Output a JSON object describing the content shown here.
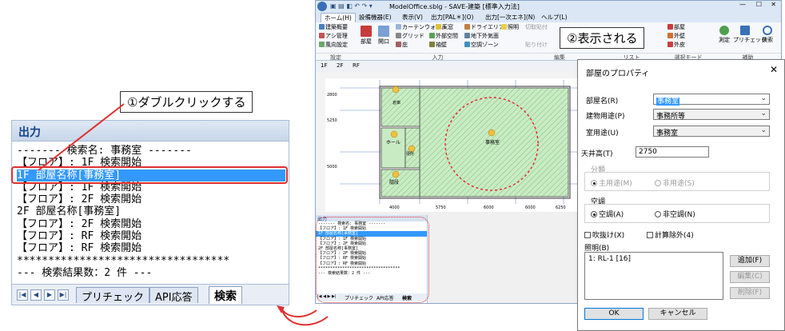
{
  "callout1": "①ダブルクリックする",
  "callout2": "②表示される",
  "output_panel": {
    "title": "出力",
    "lines": [
      "------- 検索名: 事務室 -------",
      "【フロア】: 1F 検索開始",
      "1F 部屋名称[事務室]",
      "【フロア】: 1F 検索開始",
      "【フロア】: 2F 検索開始",
      "2F 部屋名称[事務室]",
      "【フロア】: 2F 検索開始",
      "【フロア】: RF 検索開始",
      "【フロア】: RF 検索開始",
      "**********************************",
      "--- 検索結果数：2 件 ---"
    ],
    "tabs": [
      "プリチェック",
      "API応答",
      "検索"
    ]
  },
  "app": {
    "title": "ModelOffice.sblg - SAVE-建築 [標準入力法]",
    "ribbon_tabs": [
      "ホーム(H)",
      "設備機器(E)",
      "表示(V)",
      "出力[PAL＊](O)",
      "出力[一次エネ](N)",
      "ヘルプ(L)"
    ],
    "ribbon_items": [
      "建築概要",
      "アシ管理",
      "風向設定",
      "部屋",
      "開口",
      "カーテンウォール",
      "グリッド",
      "天窓",
      "外部空間",
      "ドライエリア",
      "地下外気面",
      "庇",
      "袖壁",
      "空調ゾーン",
      "照明",
      "切取貼付",
      "貼り付け",
      "部屋",
      "外壁",
      "外皮",
      "測定",
      "プリチェック",
      "検索"
    ],
    "ribbon_groups": [
      "設定",
      "入力",
      "編集",
      "リスト",
      "選択モード",
      "補助"
    ],
    "floor_tabs": [
      "1F",
      "2F",
      "RF"
    ],
    "room_labels": [
      "事務室",
      "ホール",
      "階段",
      "便所",
      "倉庫"
    ],
    "dims": [
      "4000",
      "5750",
      "6000",
      "6000",
      "6250",
      "2800",
      "5250",
      "5000"
    ],
    "mini_output": {
      "title": "出力",
      "tabs": [
        "プリチェック",
        "API応答",
        "検索"
      ]
    }
  },
  "dialog": {
    "title": "部屋のプロパティ",
    "room_name_label": "部屋名(R)",
    "room_name_value": "事務室",
    "building_use_label": "建物用途(P)",
    "building_use_value": "事務所等",
    "room_use_label": "室用途(U)",
    "room_use_value": "事務室",
    "ceiling_label": "天井高(T)",
    "ceiling_value": "2750",
    "classification_label": "分類",
    "main_use": "主用途(M)",
    "non_use": "非用途(S)",
    "ac_label": "空調",
    "ac_on": "空調(A)",
    "ac_off": "非空調(N)",
    "fukinuke": "吹抜け(X)",
    "calc_exclude": "計算除外(4)",
    "lighting_label": "照明(B)",
    "lighting_item": "1: RL-1 [16]",
    "add": "追加(F)",
    "edit": "編集(C)",
    "delete": "削除(F)",
    "ok": "OK",
    "cancel": "キャンセル"
  },
  "colors": {
    "accent_red": "#e03030",
    "selection": "#3399ff",
    "room_fill": "#c9ebc4"
  }
}
